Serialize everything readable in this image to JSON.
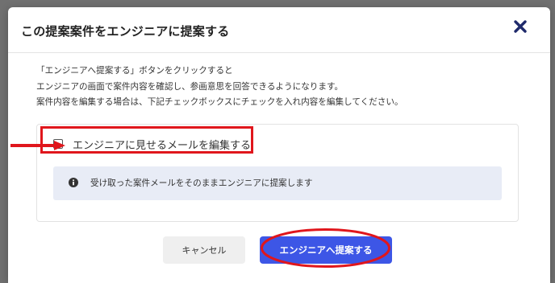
{
  "dialog": {
    "title": "この提案案件をエンジニアに提案する",
    "close_icon": "close-icon",
    "description": [
      "「エンジニアへ提案する」ボタンをクリックすると",
      "エンジニアの画面で案件内容を確認し、参画意思を回答できるようになります。",
      "案件内容を編集する場合は、下記チェックボックスにチェックを入れ内容を編集してください。"
    ],
    "checkbox": {
      "label": "エンジニアに見せるメールを編集する",
      "checked": false
    },
    "info": {
      "icon": "info-icon",
      "text": "受け取った案件メールをそのままエンジニアに提案します"
    },
    "buttons": {
      "cancel_label": "キャンセル",
      "submit_label": "エンジニアへ提案する"
    }
  },
  "colors": {
    "accent": "#3d56e6",
    "annotation": "#e0161c",
    "close_icon": "#1f2a6b",
    "info_bg": "#e8ecf6",
    "overlay": "#707070"
  }
}
